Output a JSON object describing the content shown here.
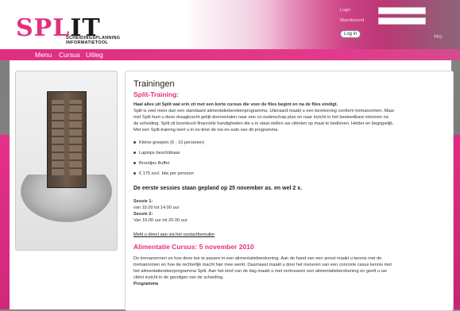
{
  "header": {
    "logo_main": "SPL",
    "logo_accent": "IT",
    "logo_sub_line1": "SCHEIDINGSPLANNING",
    "logo_sub_line2": "INFORMATIETOOL",
    "login_label": "Login",
    "password_label": "Wachtwoord",
    "login_button": "Log in",
    "deco_text": "MIS"
  },
  "nav": {
    "items": [
      "Menu",
      "Cursus",
      "Uitleg"
    ]
  },
  "main": {
    "title": "Trainingen",
    "subtitle": "Split-Training:",
    "intro_bold": "Haal alles uit Split wat erin zit met een korte cursus die voor de files begint en na de files eindigt.",
    "intro_lines": [
      "Split is veel meer dan een standaard alimentatieberekenprogramma. Uiteraard maakt u een berekening conform tremanormen. Maar",
      "met Split kunt u deze draagkracht gelijk doorvertalen naar een co-ouderschap plan en naar inzicht in het besteedbare inkomen na",
      "de scheiding. Split zit boordevol financiële handigheden die u in staat stellen uw cliënten op maat te bedienen. Helder en begrijpelijk.",
      "Met een Split-training leert u in no-time de ins-en-outs van dit programma."
    ],
    "bullets": [
      "Kleine groepen (6 - 10 personen)",
      "Laptops beschikbaar",
      "Broodjes Buffet",
      "€ 175 excl. btw per persoon"
    ],
    "sessions_heading": "De eerste sessies staan gepland op 25 november as. en wel 2 x.",
    "session1_label": "Sessie 1:",
    "session1_time": "van 10.00 tot 14.00 uur",
    "session2_label": "Sessie 2:",
    "session2_time": "Van 16.00 uur tot 20.00 uur",
    "signup_link": "Meld u direct aan via het contactformulier",
    "course_heading": "Alimentatie Cursus: 5 november 2010",
    "course_lines": [
      "De tremanormen en hoe deze toe te passen in een alimentatieberekening. Aan de hand van een arrest maakt u kennis met de",
      "tremanormen en hoe de rechterlijk macht hier mee werkt. Daarnaast maakt u door het invoeren van een concrete casus kennis met",
      "het alimentatierekenprogramma Split. Aan het eind van de dag maakt u met vertrouwen een alimentatieberekening en geeft u uw",
      "cliënt inzicht in de gevolgen van de scheiding."
    ],
    "program_label": "Programma"
  },
  "colors": {
    "brand_pink": "#e2307f",
    "nav_pink": "#df2e82"
  }
}
